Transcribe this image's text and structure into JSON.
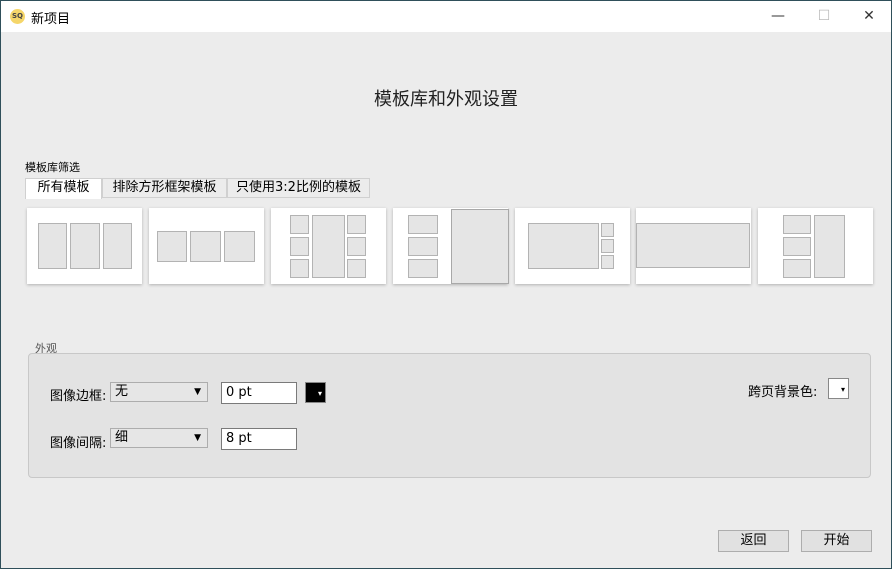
{
  "window": {
    "title": "新项目",
    "logo": "SQ",
    "min": "—",
    "max": "☐",
    "close": "✕"
  },
  "heading": "模板库和外观设置",
  "filter": {
    "label": "模板库筛选",
    "tabs": [
      {
        "label": "所有模板",
        "active": true
      },
      {
        "label": "排除方形框架模板"
      },
      {
        "label": "只使用3:2比例的模板"
      }
    ]
  },
  "templates": [
    "three-columns",
    "three-squares",
    "six-small-one-tall",
    "three-left-big-right",
    "big-left-three-small-right",
    "wide-banner",
    "three-left-tall-right"
  ],
  "appearance": {
    "label": "外观",
    "border_label": "图像边框:",
    "border_value": "无",
    "border_width": "0 pt",
    "border_color": "#000000",
    "spacing_label": "图像间隔:",
    "spacing_value": "细",
    "spacing_width": "8 pt",
    "bg_label": "跨页背景色:",
    "bg_color": "#ffffff"
  },
  "buttons": {
    "back": "返回",
    "start": "开始"
  }
}
